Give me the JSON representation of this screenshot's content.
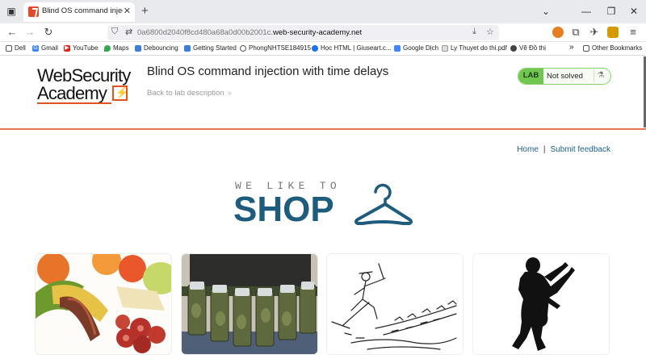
{
  "browser": {
    "tab_title": "Blind OS command injection w",
    "url_path": "0a6800d2040f8cd480a68a0d00b2001c.",
    "url_host": "web-security-academy.net",
    "bookmarks": [
      "Dell",
      "Gmail",
      "YouTube",
      "Maps",
      "Debouncing",
      "Getting Started",
      "PhongNHTSE184915",
      "Học HTML | Giuseart.c...",
      "Google Dịch",
      "Ly Thuyet do thi.pdf",
      "Vẽ Đồ thị",
      "Other Bookmarks"
    ]
  },
  "lab": {
    "logo_line1": "WebSecurity",
    "logo_line2": "Academy",
    "title": "Blind OS command injection with time delays",
    "back_link": "Back to lab description",
    "badge": "LAB",
    "status": "Not solved"
  },
  "nav": {
    "home": "Home",
    "separator": "|",
    "feedback": "Submit feedback"
  },
  "shop": {
    "tagline": "WE LIKE TO",
    "word": "SHOP"
  },
  "colors": {
    "accent_orange": "#e2531f",
    "shop_blue": "#1e5c7d",
    "lab_green": "#70c64f",
    "link_blue": "#1b5f8c"
  },
  "products": [
    {
      "image": "food-platter-sausage-image"
    },
    {
      "image": "beer-belt-image"
    },
    {
      "image": "sketch-skier-image"
    },
    {
      "image": "silhouette-figure-image"
    }
  ]
}
